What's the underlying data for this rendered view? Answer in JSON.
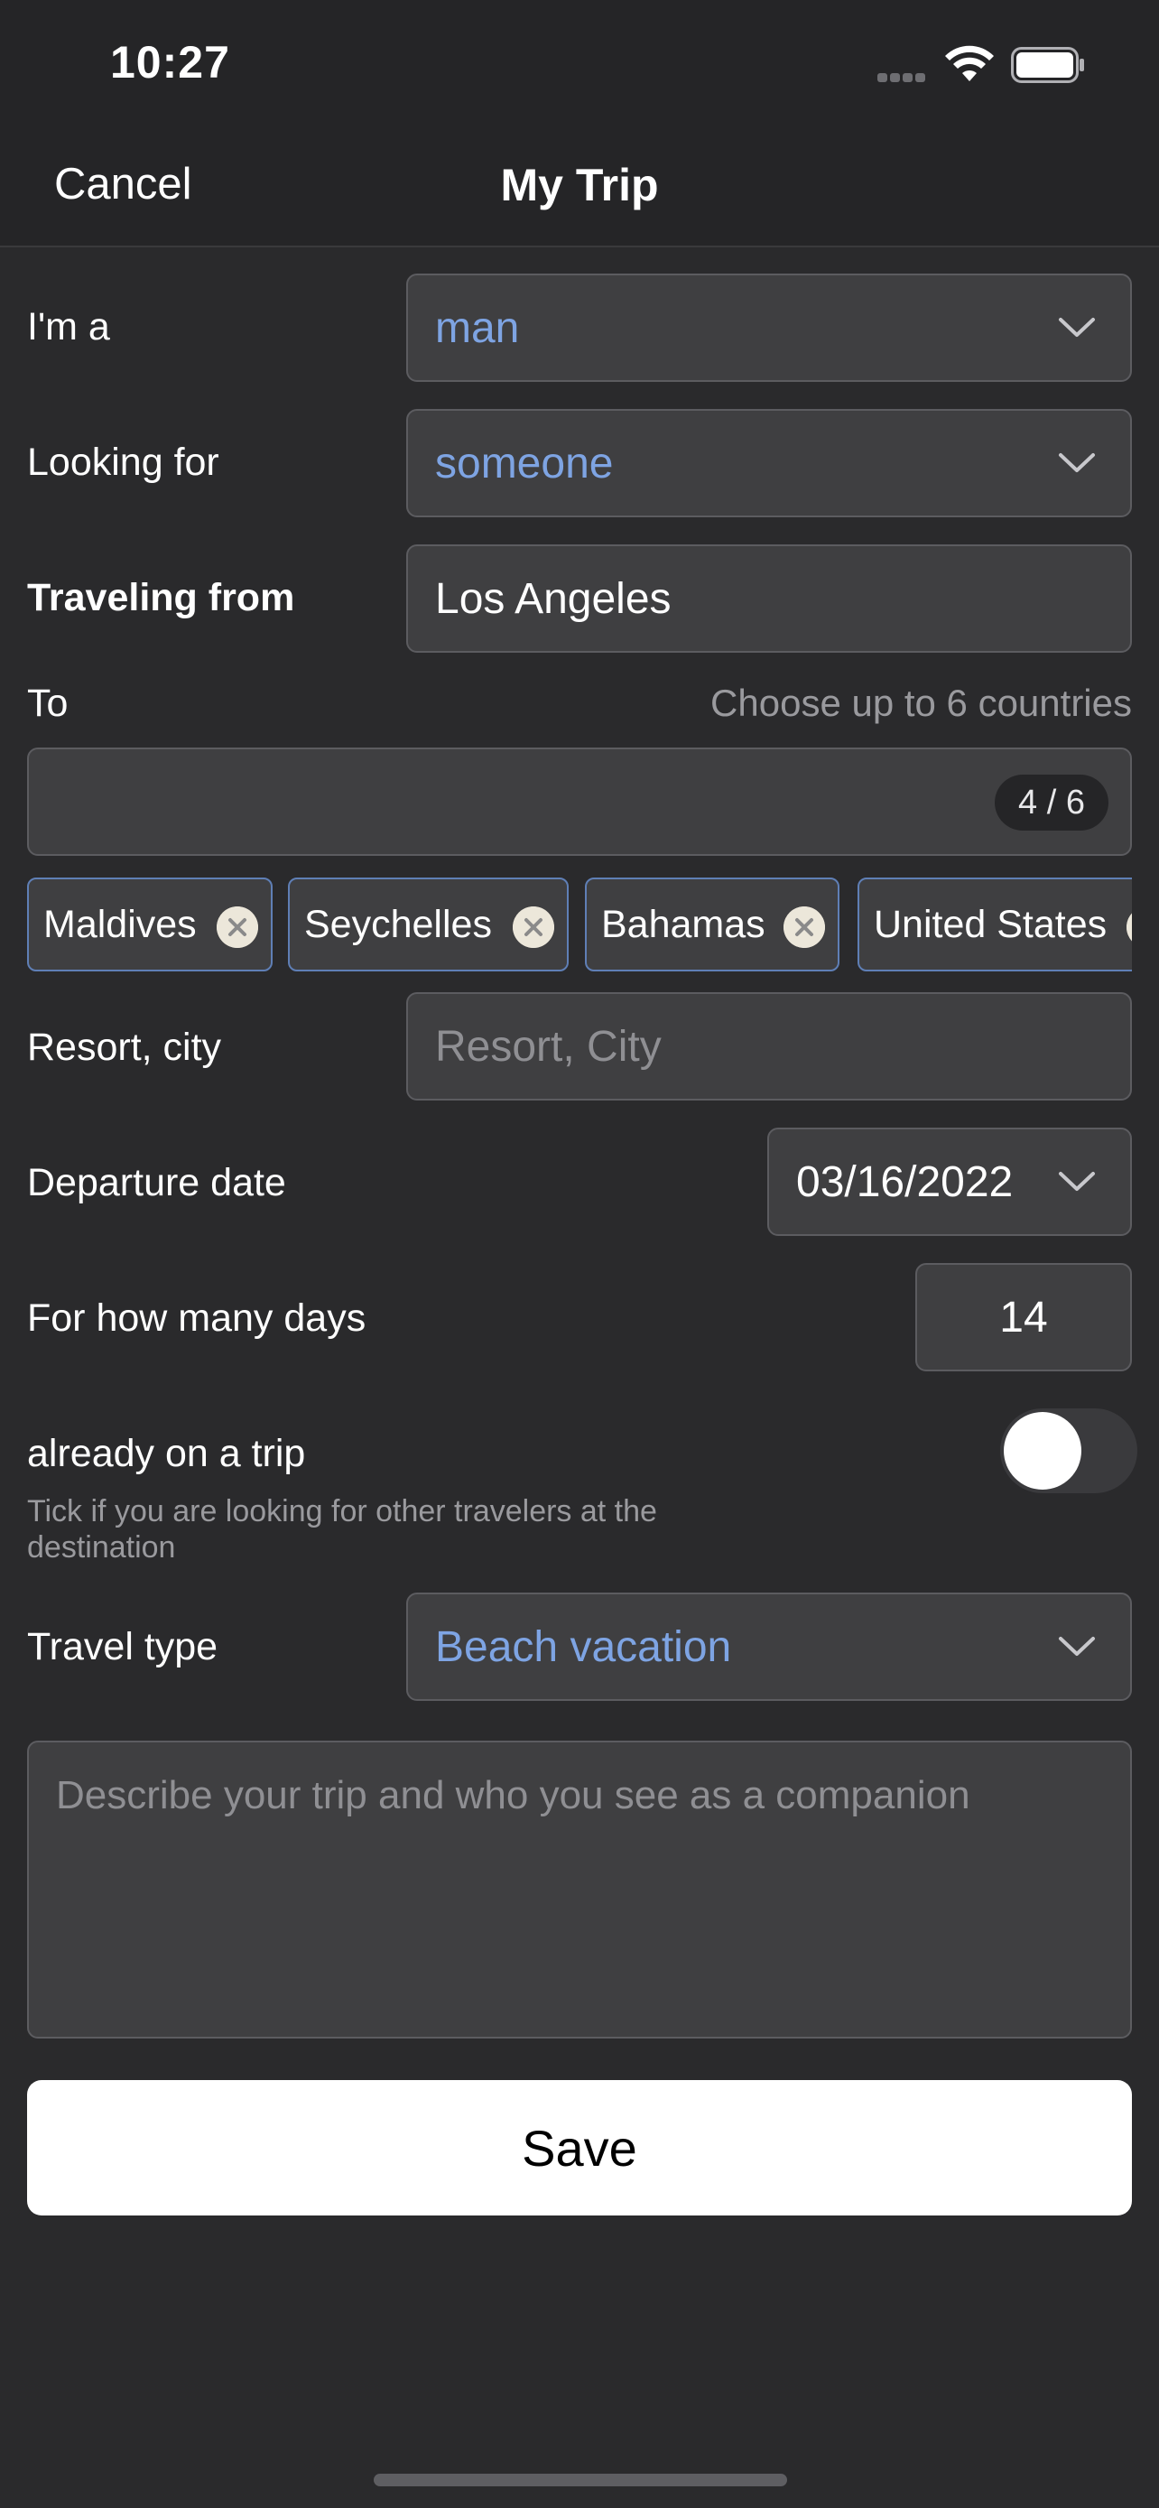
{
  "status_bar": {
    "time": "10:27"
  },
  "nav": {
    "cancel_label": "Cancel",
    "title": "My Trip"
  },
  "form": {
    "gender": {
      "label": "I'm a",
      "value": "man"
    },
    "looking_for": {
      "label": "Looking for",
      "value": "someone"
    },
    "traveling_from": {
      "label": "Traveling from",
      "value": "Los Angeles"
    },
    "to": {
      "label": "To",
      "hint": "Choose up to 6 countries",
      "input_value": "",
      "counter": "4 / 6",
      "chips": [
        "Maldives",
        "Seychelles",
        "Bahamas",
        "United States"
      ]
    },
    "resort": {
      "label": "Resort, city",
      "placeholder": "Resort, City"
    },
    "departure": {
      "label": "Departure date",
      "value": "03/16/2022"
    },
    "days": {
      "label": "For how many days",
      "value": "14"
    },
    "on_trip": {
      "label": "already on a trip",
      "hint": "Tick if you are looking for other travelers at the destination",
      "enabled": false
    },
    "travel_type": {
      "label": "Travel type",
      "value": "Beach vacation"
    },
    "description": {
      "placeholder": "Describe your trip and who you see as a companion"
    }
  },
  "save_label": "Save",
  "colors": {
    "background": "#2a2a2c",
    "field": "#3f3f41",
    "accent_blue": "#7ea4e3",
    "chip_border": "#5f7fb6"
  }
}
